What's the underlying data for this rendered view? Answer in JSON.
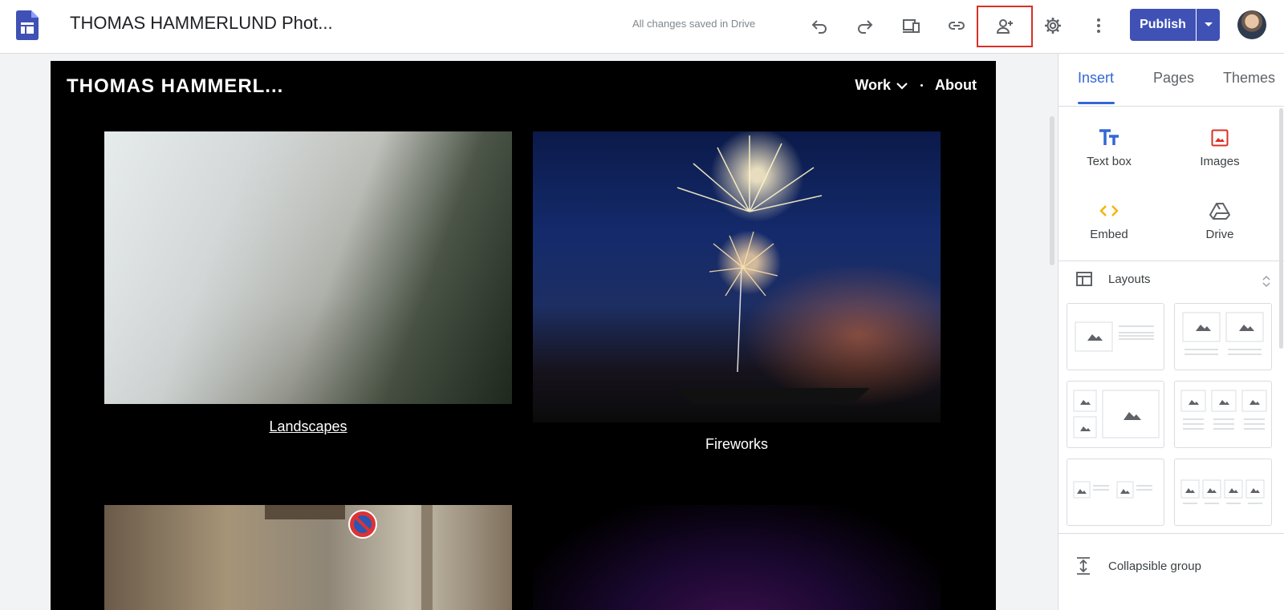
{
  "header": {
    "doc_title": "THOMAS HAMMERLUND Phot...",
    "save_status": "All changes saved in Drive",
    "publish_label": "Publish"
  },
  "site": {
    "title": "THOMAS HAMMERL...",
    "nav": [
      {
        "label": "Work"
      },
      {
        "label": "About"
      }
    ],
    "tiles": [
      {
        "label": "Landscapes"
      },
      {
        "label": "Fireworks"
      }
    ]
  },
  "panel": {
    "tabs": [
      {
        "label": "Insert"
      },
      {
        "label": "Pages"
      },
      {
        "label": "Themes"
      }
    ],
    "insert_items": [
      {
        "label": "Text box",
        "icon": "text-box-icon"
      },
      {
        "label": "Images",
        "icon": "image-icon"
      },
      {
        "label": "Embed",
        "icon": "embed-icon"
      },
      {
        "label": "Drive",
        "icon": "drive-icon"
      }
    ],
    "layouts_label": "Layouts",
    "collapsible_label": "Collapsible group"
  },
  "colors": {
    "accent": "#3367d6",
    "publish": "#3f51b5",
    "share_highlight": "#d93025",
    "image_icon": "#d93025",
    "embed_icon": "#f4b400"
  }
}
